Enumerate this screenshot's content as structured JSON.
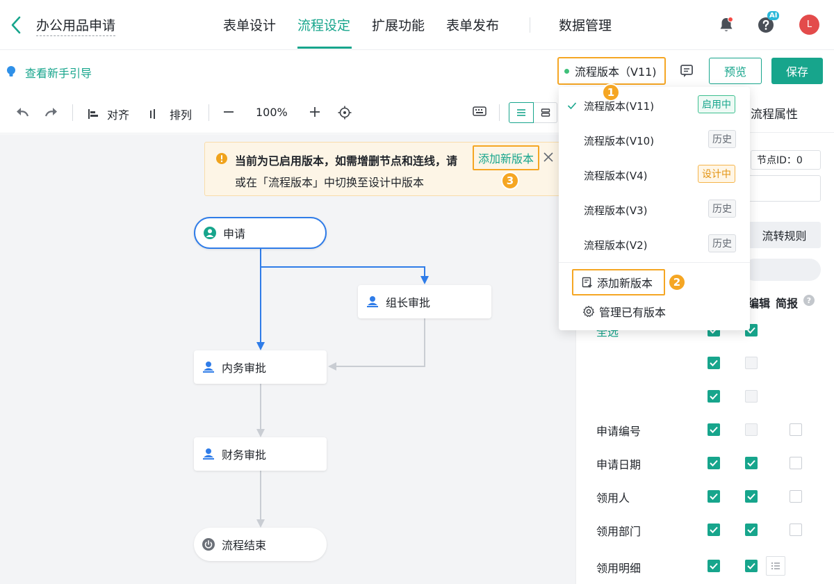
{
  "header": {
    "title": "办公用品申请",
    "tabs": [
      {
        "label": "表单设计"
      },
      {
        "label": "流程设定"
      },
      {
        "label": "扩展功能"
      },
      {
        "label": "表单发布"
      },
      {
        "label": "数据管理"
      }
    ],
    "ai_badge": "AI",
    "avatar_initial": "L",
    "accent_color": "#17a58c"
  },
  "subbar": {
    "guide_link": "查看新手引导",
    "version_button": "流程版本（V11)",
    "preview": "预览",
    "save": "保存"
  },
  "toolbar": {
    "align": "对齐",
    "arrange": "排列",
    "zoom": "100%"
  },
  "warning": {
    "line1": "当前为已启用版本，如需增删节点和连线，请",
    "link": "添加新版本",
    "line2": "或在「流程版本」中切换至设计中版本"
  },
  "nodes": {
    "apply": "申请",
    "group_review": "组长审批",
    "internal_review": "内务审批",
    "finance_review": "财务审批",
    "end": "流程结束"
  },
  "badges": [
    "1",
    "2",
    "3"
  ],
  "version_menu": {
    "items": [
      {
        "label": "流程版本(V11)",
        "status": "启用中",
        "checked": true
      },
      {
        "label": "流程版本(V10)",
        "status": "历史"
      },
      {
        "label": "流程版本(V4)",
        "status": "设计中"
      },
      {
        "label": "流程版本(V3)",
        "status": "历史"
      },
      {
        "label": "流程版本(V2)",
        "status": "历史"
      }
    ],
    "add_version": "添加新版本",
    "manage_versions": "管理已有版本"
  },
  "panel": {
    "title": "流程属性",
    "node_id": "节点ID：0",
    "flow_rule": "流转规则",
    "col_edit": "编辑",
    "col_brief": "简报",
    "help": "?",
    "select_all": "全选",
    "fields": [
      {
        "label": "申请编号"
      },
      {
        "label": "申请日期"
      },
      {
        "label": "领用人"
      },
      {
        "label": "领用部门"
      },
      {
        "label": "领用明细"
      }
    ]
  }
}
